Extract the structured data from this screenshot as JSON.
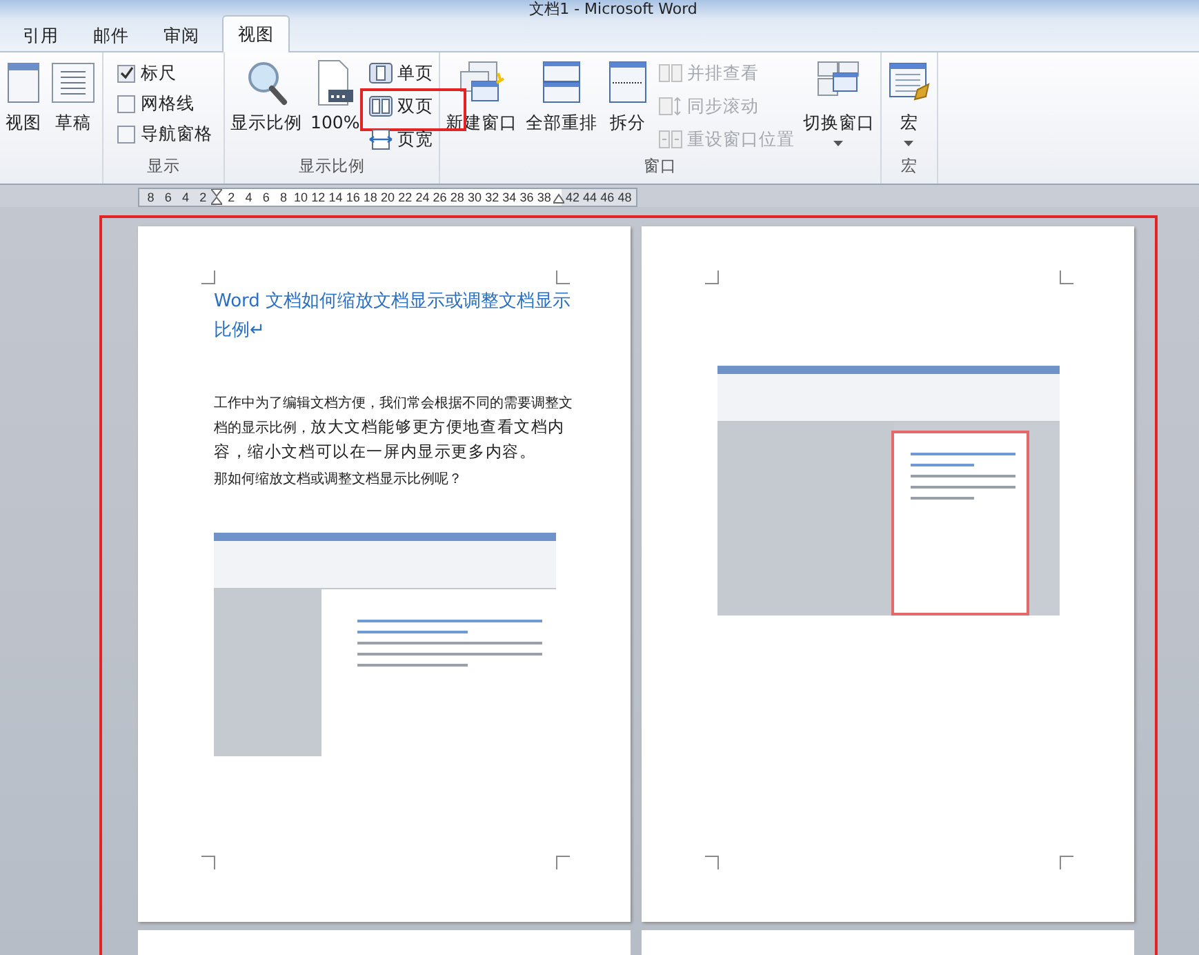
{
  "window": {
    "title": "文档1 - Microsoft Word"
  },
  "tabs": [
    {
      "label": "引用",
      "selected": false
    },
    {
      "label": "邮件",
      "selected": false
    },
    {
      "label": "审阅",
      "selected": false
    },
    {
      "label": "视图",
      "selected": true
    }
  ],
  "ribbon": {
    "groups": [
      {
        "columns": [
          [
            {
              "kind": "large",
              "label": "视图",
              "dropdown": false
            }
          ],
          [
            {
              "kind": "large",
              "label": "草稿",
              "dropdown": false
            }
          ]
        ]
      },
      {
        "label": "显示",
        "columns": [
          [
            {
              "kind": "check",
              "label": "标尺",
              "checked": true
            },
            {
              "kind": "check",
              "label": "网格线",
              "checked": false
            },
            {
              "kind": "check",
              "label": "导航窗格",
              "checked": false
            }
          ]
        ]
      },
      {
        "label": "显示比例",
        "columns": [
          [
            {
              "kind": "large",
              "label": "显示比例",
              "dropdown": false
            }
          ],
          [
            {
              "kind": "large",
              "label": "100%",
              "dropdown": false
            }
          ],
          [
            {
              "kind": "small",
              "label": "单页",
              "disabled": false,
              "marked": false
            },
            {
              "kind": "small",
              "label": "双页",
              "disabled": false,
              "marked": true
            },
            {
              "kind": "small",
              "label": "页宽",
              "disabled": false,
              "marked": false
            }
          ]
        ]
      },
      {
        "label": "窗口",
        "columns": [
          [
            {
              "kind": "large",
              "label": "新建窗口",
              "dropdown": false
            }
          ],
          [
            {
              "kind": "large",
              "label": "全部重排",
              "dropdown": false
            }
          ],
          [
            {
              "kind": "large",
              "label": "拆分",
              "dropdown": false
            }
          ],
          [
            {
              "kind": "small",
              "label": "并排查看",
              "disabled": true,
              "marked": false
            },
            {
              "kind": "small",
              "label": "同步滚动",
              "disabled": true,
              "marked": false
            },
            {
              "kind": "small",
              "label": "重设窗口位置",
              "disabled": true,
              "marked": false
            }
          ],
          [
            {
              "kind": "large",
              "label": "切换窗口",
              "dropdown": true
            }
          ]
        ]
      },
      {
        "label": "宏",
        "columns": [
          [
            {
              "kind": "large",
              "label": "宏",
              "dropdown": true
            }
          ]
        ]
      }
    ]
  },
  "ruler": {
    "labels": [
      "8",
      "6",
      "4",
      "2",
      "2",
      "4",
      "6",
      "8",
      "10",
      "12",
      "14",
      "16",
      "18",
      "20",
      "22",
      "24",
      "26",
      "28",
      "30",
      "32",
      "34",
      "36",
      "38",
      "42",
      "44",
      "46",
      "48"
    ]
  },
  "document": {
    "marked": true,
    "pages": [
      {
        "heading": "Word 文档如何缩放文档显示或调整文档显示比例↵",
        "paragraphs": [
          [
            {
              "kind": "small",
              "text": "工作中为了编辑文档方便，我们常会根据不同的需要调整文档的显示比例，"
            },
            {
              "kind": "large",
              "text": "放大文档能够更方便地查看文档内容，缩小文档可以在一屏内显示更多内容。"
            }
          ],
          [
            {
              "kind": "small",
              "text": "那如何缩放文档或调整文档显示比例呢？"
            }
          ]
        ],
        "figure": {
          "kind": "document-view"
        }
      },
      {
        "figure": {
          "kind": "zoomed-view"
        }
      }
    ]
  }
}
